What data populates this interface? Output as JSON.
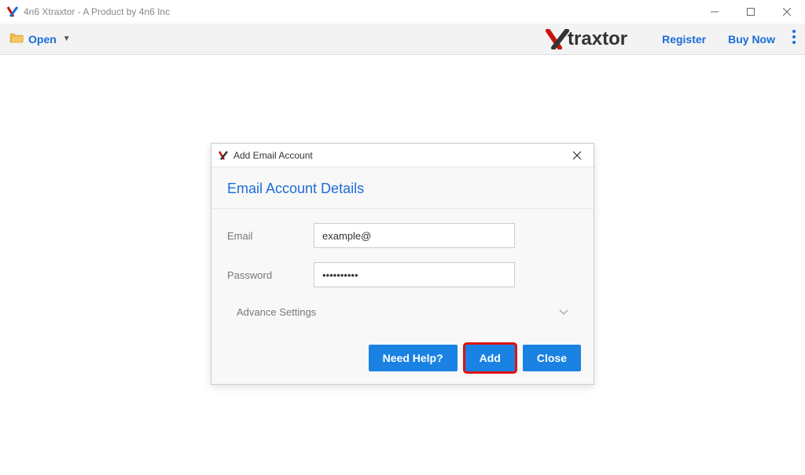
{
  "titlebar": {
    "title": "4n6 Xtraxtor - A Product by 4n6 Inc"
  },
  "toolbar": {
    "open_label": "Open",
    "register_label": "Register",
    "buy_now_label": "Buy Now",
    "brand_text": "traxtor"
  },
  "dialog": {
    "title": "Add Email Account",
    "section_header": "Email Account Details",
    "email_label": "Email",
    "email_value": "example@",
    "password_label": "Password",
    "password_value": "••••••••••",
    "advance_label": "Advance Settings",
    "need_help_label": "Need Help?",
    "add_label": "Add",
    "close_label": "Close"
  }
}
